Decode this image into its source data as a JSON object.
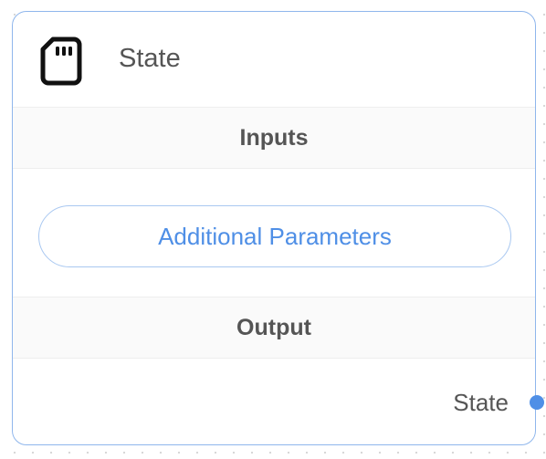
{
  "node": {
    "title": "State",
    "icon": "sd-card-icon",
    "inputs_label": "Inputs",
    "additional_parameters_label": "Additional Parameters",
    "output_label": "Output",
    "outputs": [
      {
        "label": "State"
      }
    ]
  },
  "colors": {
    "accent": "#4f8fe6",
    "border": "#8fb6ec",
    "text": "#555555",
    "section_bg": "#fafafa"
  }
}
